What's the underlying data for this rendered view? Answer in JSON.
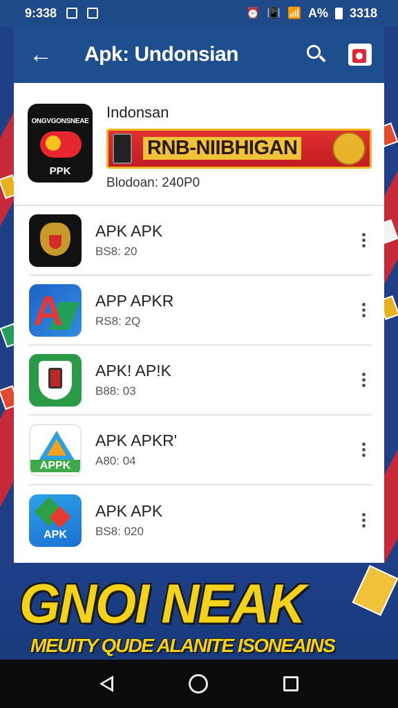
{
  "status_bar": {
    "time": "9:338",
    "battery_text": "A%",
    "right_text": "3318"
  },
  "app_bar": {
    "title": "Apk: Undonsian",
    "icons": [
      "back-arrow-icon",
      "search-icon",
      "store-icon"
    ]
  },
  "featured": {
    "title": "Indonsan",
    "icon_top_text": "ONGVGONSNEAE",
    "icon_label": "PPK",
    "banner_text": "RNB-NIIBHIGAN",
    "subtitle": "Blodoan: 240P0"
  },
  "apps": [
    {
      "title": "APK APK",
      "subtitle": "BS8: 20",
      "icon": "garuda-icon"
    },
    {
      "title": "APP APKR",
      "subtitle": "RS8: 2Q",
      "icon": "letter-a-icon"
    },
    {
      "title": "APK! AP!K",
      "subtitle": "B88: 03",
      "icon": "phone-shield-icon"
    },
    {
      "title": "APK APKR'",
      "subtitle": "A80: 04",
      "icon": "apk-triangle-icon",
      "icon_label": "APPK"
    },
    {
      "title": "APK APK",
      "subtitle": "BS8: 020",
      "icon": "apk-play-icon",
      "icon_label": "APK"
    }
  ],
  "promo": {
    "headline": "GNOI NEAK",
    "subline": "MEUITY QUDE ALANITE ISONEAINS"
  },
  "colors": {
    "app_bar": "#1d4f8e",
    "background": "#1f3f86",
    "promo_text": "#f5d21a"
  }
}
